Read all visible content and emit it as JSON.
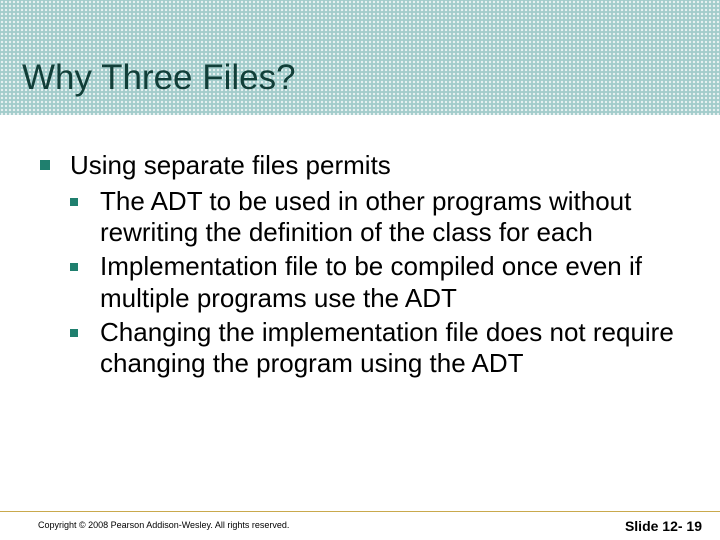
{
  "title": "Why Three Files?",
  "body": {
    "main": "Using separate files permits",
    "sub": [
      "The ADT to be used in other programs without rewriting the definition of the class for each",
      "Implementation file to be compiled once even if multiple programs use the ADT",
      "Changing the implementation file does not require changing the program using the ADT"
    ]
  },
  "footer": {
    "copyright": "Copyright © 2008 Pearson Addison-Wesley. All rights reserved.",
    "slide": "Slide 12- 19"
  }
}
